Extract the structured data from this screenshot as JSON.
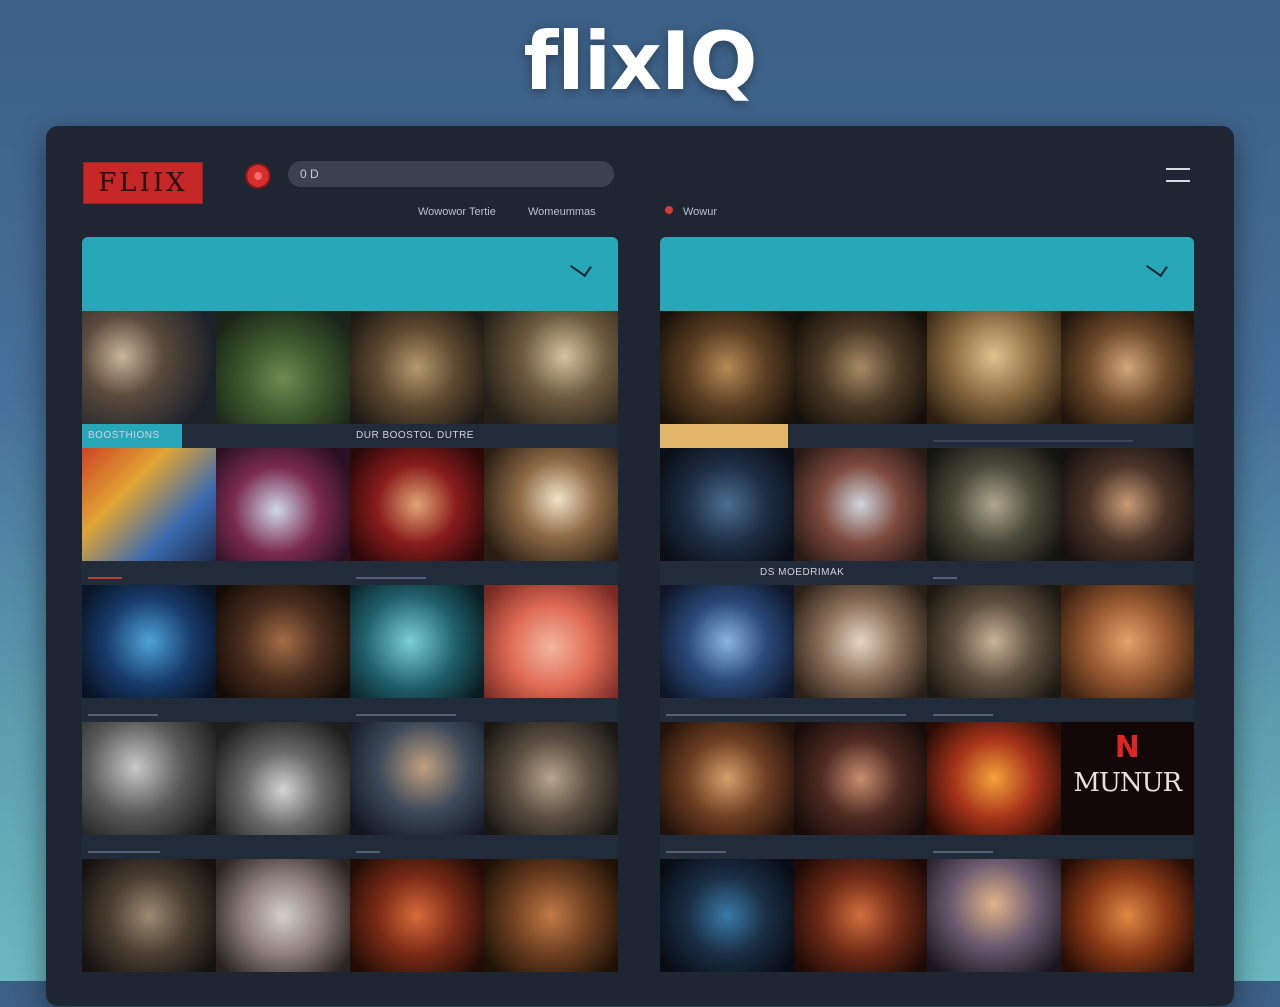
{
  "brand": "flixIQ",
  "app": {
    "logo_text": "FLIIX",
    "search_value": "0 D"
  },
  "nav": {
    "item_a": "Wowowor Tertie",
    "item_b": "Womeummas",
    "item_c": "Wowur"
  },
  "left_panel": {
    "captions": [
      "BOOSTHIONS",
      "DUR BOOSTOL DUTRE"
    ]
  },
  "right_panel": {
    "captions": [
      "DS MOEDRIMAK"
    ],
    "tile_logo_letter": "N",
    "tile_logo_word": "MUNUR"
  }
}
